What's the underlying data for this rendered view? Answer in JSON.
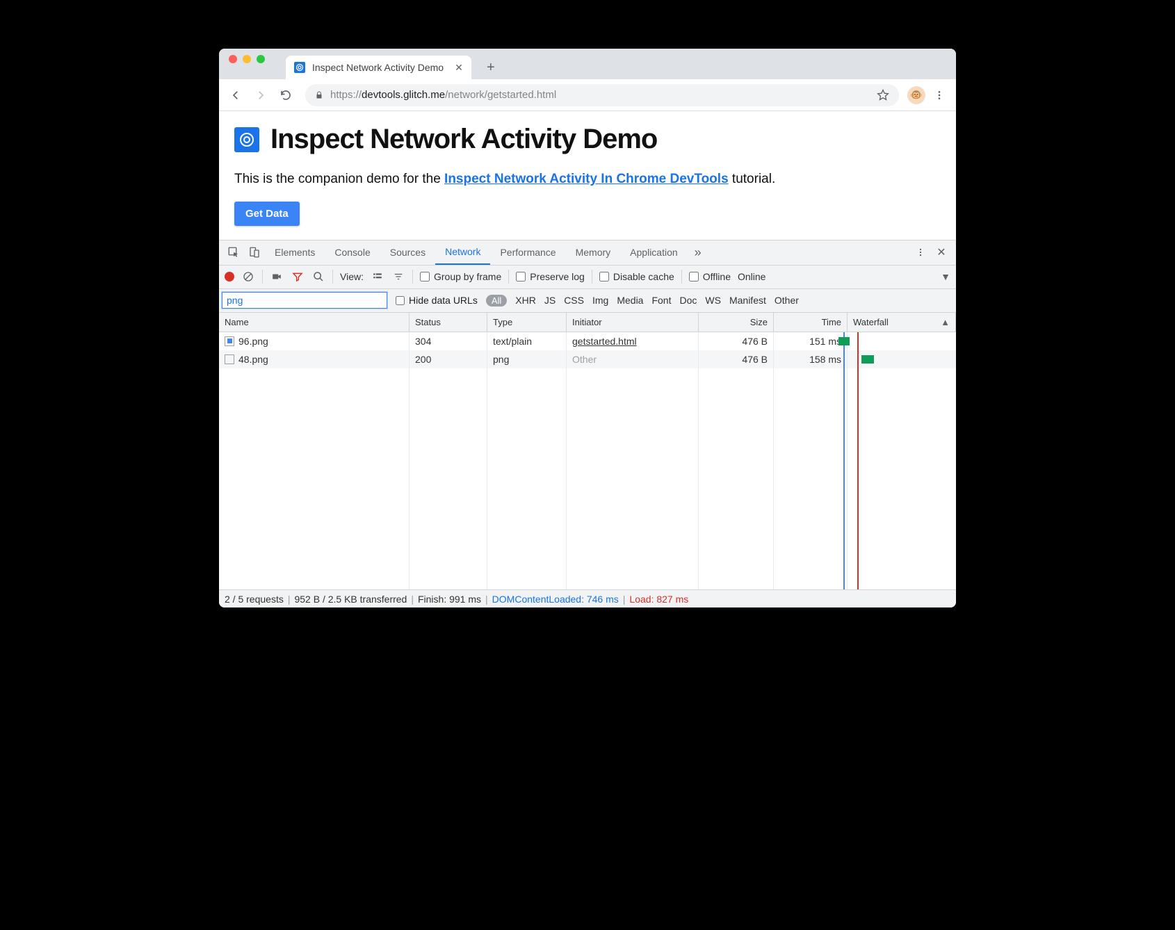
{
  "browser": {
    "tab_title": "Inspect Network Activity Demo",
    "url_scheme": "https://",
    "url_host": "devtools.glitch.me",
    "url_path": "/network/getstarted.html"
  },
  "page": {
    "heading": "Inspect Network Activity Demo",
    "intro_prefix": "This is the companion demo for the ",
    "intro_link": "Inspect Network Activity In Chrome DevTools",
    "intro_suffix": " tutorial.",
    "button_label": "Get Data"
  },
  "devtools": {
    "tabs": [
      "Elements",
      "Console",
      "Sources",
      "Network",
      "Performance",
      "Memory",
      "Application"
    ],
    "active_tab": "Network",
    "toolbar": {
      "view_label": "View:",
      "group_by_frame": "Group by frame",
      "preserve_log": "Preserve log",
      "disable_cache": "Disable cache",
      "offline": "Offline",
      "online": "Online"
    },
    "filter": {
      "value": "png",
      "hide_data_urls": "Hide data URLs",
      "all_pill": "All",
      "types": [
        "XHR",
        "JS",
        "CSS",
        "Img",
        "Media",
        "Font",
        "Doc",
        "WS",
        "Manifest",
        "Other"
      ]
    },
    "columns": {
      "name": "Name",
      "status": "Status",
      "type": "Type",
      "initiator": "Initiator",
      "size": "Size",
      "time": "Time",
      "waterfall": "Waterfall"
    },
    "rows": [
      {
        "name": "96.png",
        "status": "304",
        "type": "text/plain",
        "initiator": "getstarted.html",
        "initiator_link": true,
        "size": "476 B",
        "time": "151 ms",
        "icon_filled": true
      },
      {
        "name": "48.png",
        "status": "200",
        "type": "png",
        "initiator": "Other",
        "initiator_link": false,
        "size": "476 B",
        "time": "158 ms",
        "icon_filled": false
      }
    ],
    "status": {
      "requests": "2 / 5 requests",
      "transferred": "952 B / 2.5 KB transferred",
      "finish": "Finish: 991 ms",
      "dcl": "DOMContentLoaded: 746 ms",
      "load": "Load: 827 ms"
    }
  }
}
